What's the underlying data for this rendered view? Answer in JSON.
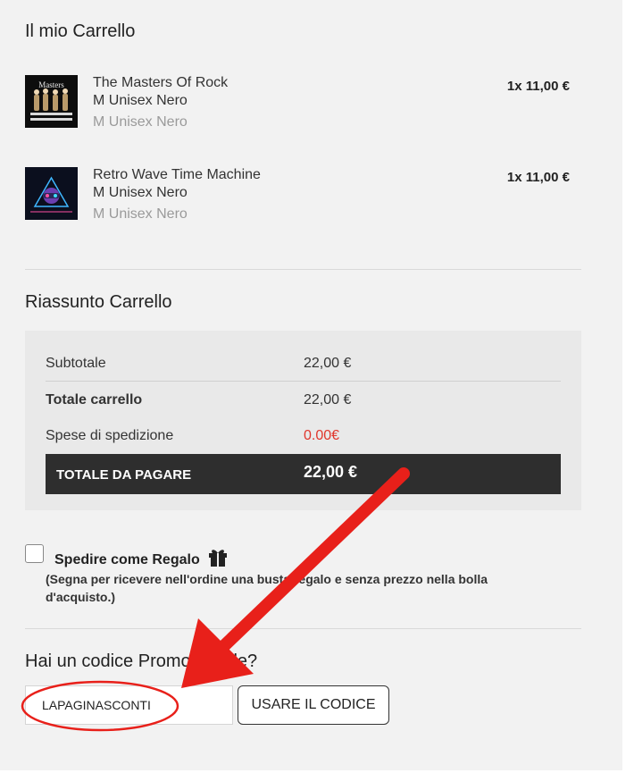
{
  "cart": {
    "title": "Il mio Carrello",
    "items": [
      {
        "name": "The Masters Of Rock",
        "variant": "M Unisex Nero",
        "variant_secondary": "M Unisex Nero",
        "qty_price": "1x 11,00 €",
        "thumb_text": "Masters"
      },
      {
        "name": "Retro Wave Time Machine",
        "variant": "M Unisex Nero",
        "variant_secondary": "M Unisex Nero",
        "qty_price": "1x 11,00 €"
      }
    ]
  },
  "summary": {
    "title": "Riassunto Carrello",
    "subtotal_label": "Subtotale",
    "subtotal_value": "22,00 €",
    "cart_total_label": "Totale carrello",
    "cart_total_value": "22,00 €",
    "shipping_label": "Spese di spedizione",
    "shipping_value": "0.00€",
    "pay_total_label": "TOTALE DA PAGARE",
    "pay_total_value": "22,00 €"
  },
  "gift": {
    "label": "Spedire come Regalo",
    "icon": "gift-icon",
    "note": "(Segna per ricevere nell'ordine una busta regalo e senza prezzo nella bolla d'acquisto.)"
  },
  "promo": {
    "title": "Hai un codice Promozionale?",
    "code_value": "LAPAGINASCONTI",
    "apply_label": "USARE IL CODICE"
  },
  "colors": {
    "panel_bg": "#f2f2f2",
    "summary_bg": "#e9e9e9",
    "total_bar_bg": "#2e2e2e",
    "shipping_value": "#e0362c",
    "annotation_red": "#e8201a"
  }
}
